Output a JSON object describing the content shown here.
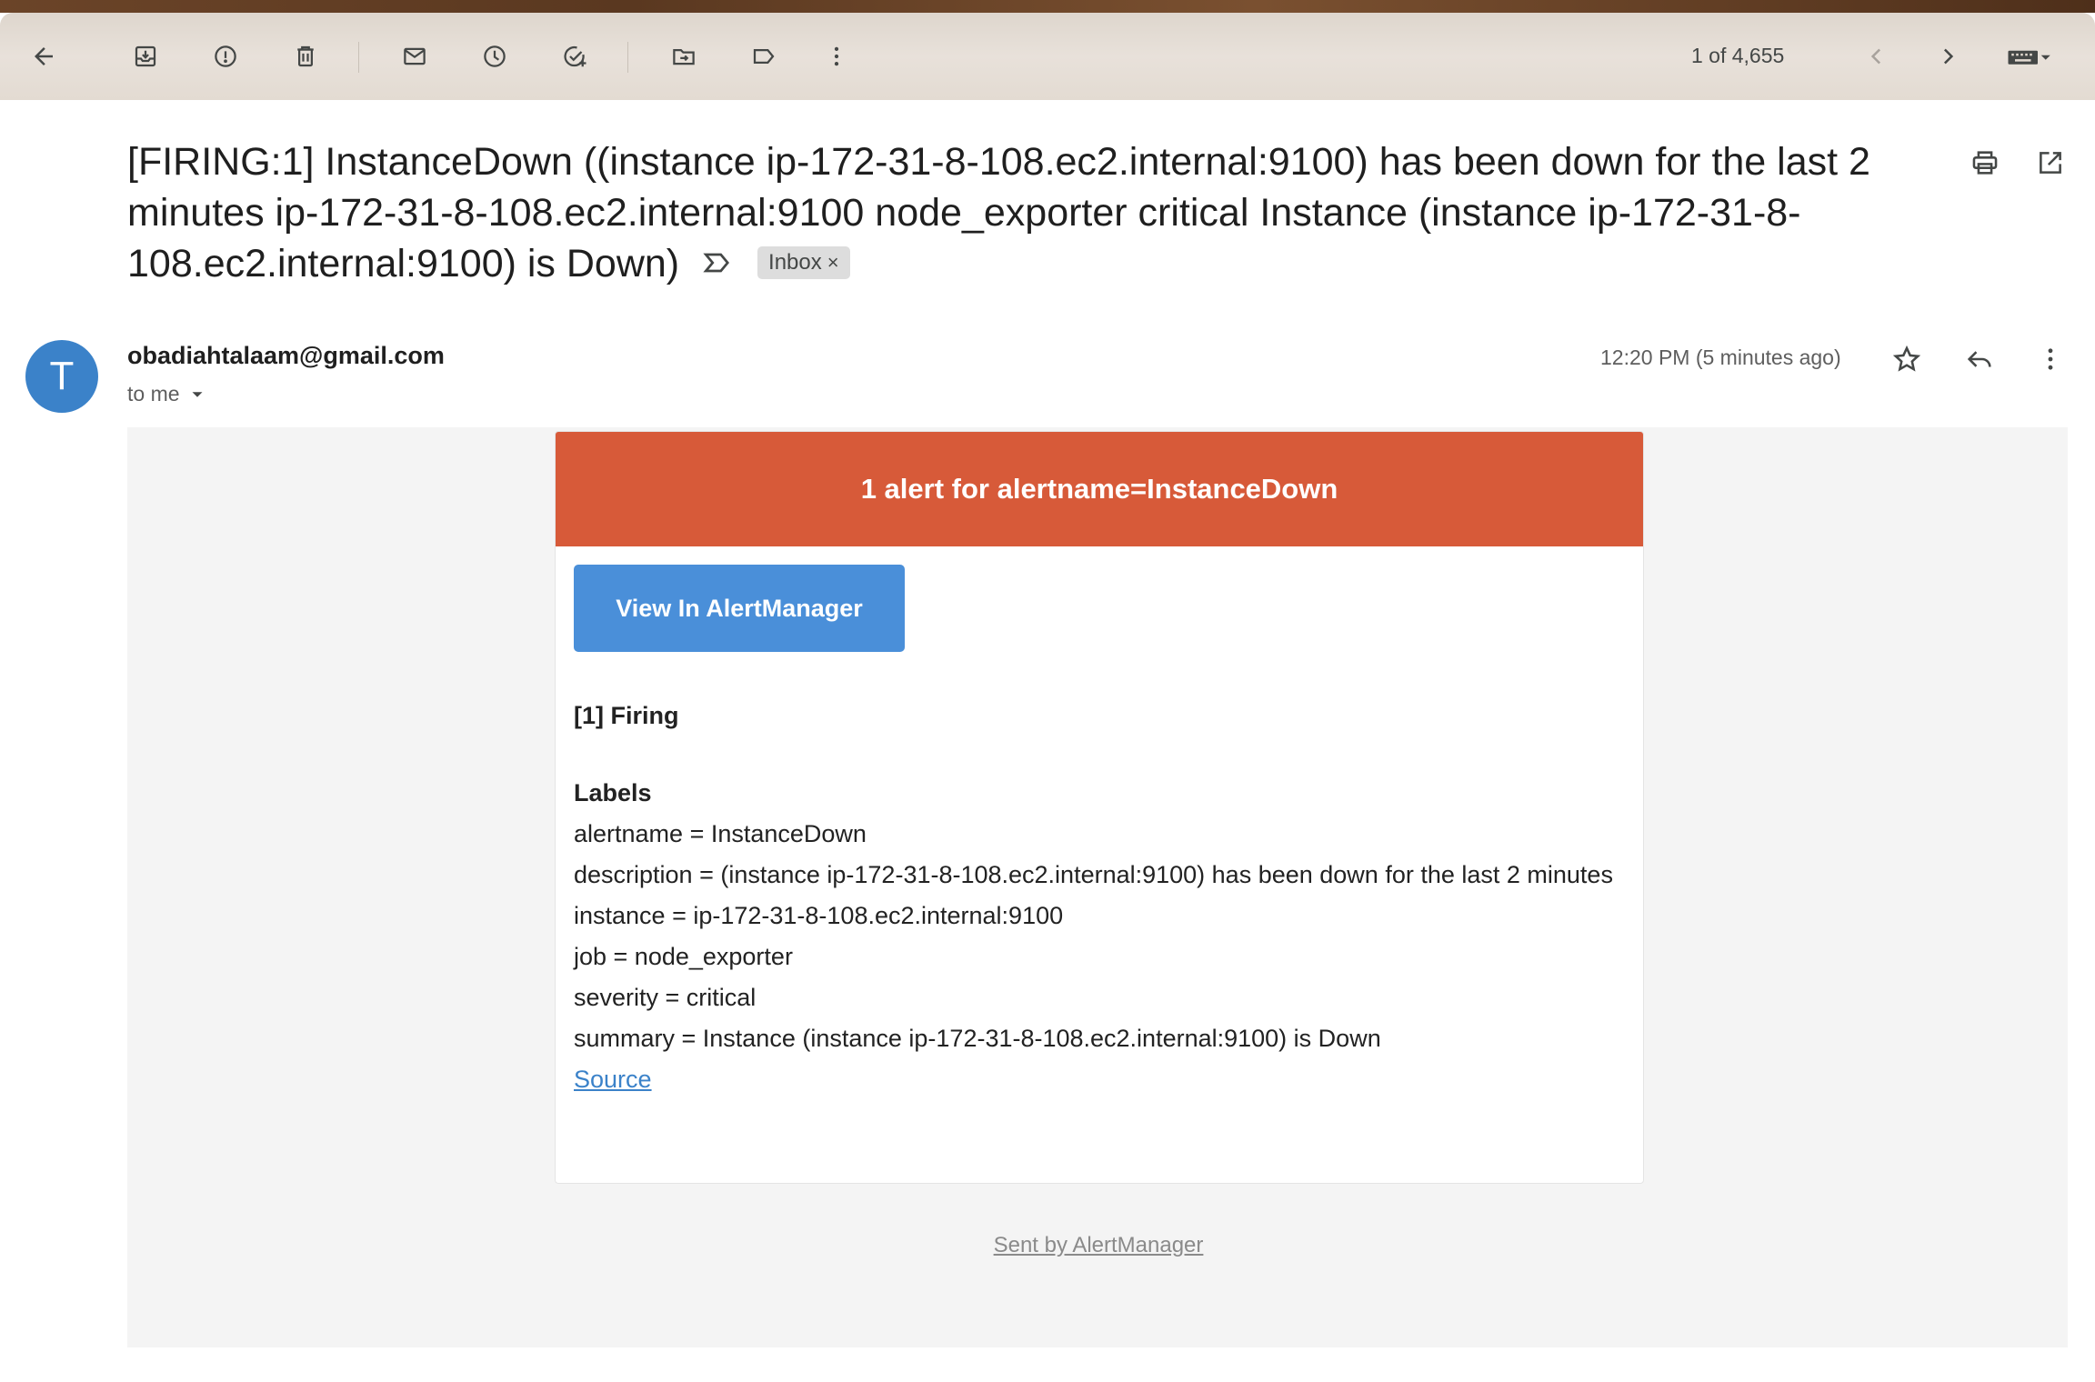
{
  "toolbar": {
    "icons": [
      "back-arrow-icon",
      "archive-icon",
      "report-spam-icon",
      "delete-icon",
      "mark-unread-icon",
      "snooze-icon",
      "add-task-icon",
      "move-to-icon",
      "label-icon",
      "more-vert-icon"
    ],
    "pager_count": "1 of 4,655",
    "input_tools_icon": "keyboard-icon"
  },
  "email": {
    "subject": "[FIRING:1] InstanceDown ((instance ip-172-31-8-108.ec2.internal:9100) has been down for the last 2 minutes ip-172-31-8-108.ec2.internal:9100 node_exporter critical Instance (instance ip-172-31-8-108.ec2.internal:9100) is Down)",
    "label_chip": "Inbox",
    "label_chip_remove": "×",
    "sender_initial": "T",
    "sender": "obadiahtalaam@gmail.com",
    "recipient": "to me",
    "time": "12:20 PM (5 minutes ago)"
  },
  "alert": {
    "banner": "1 alert for alertname=InstanceDown",
    "button": "View In AlertManager",
    "firing": "[1] Firing",
    "labels_heading": "Labels",
    "labels": [
      "alertname = InstanceDown",
      "description = (instance ip-172-31-8-108.ec2.internal:9100) has been down for the last 2 minutes",
      "instance = ip-172-31-8-108.ec2.internal:9100",
      "job = node_exporter",
      "severity = critical",
      "summary = Instance (instance ip-172-31-8-108.ec2.internal:9100) is Down"
    ],
    "source_link": "Source",
    "footer": "Sent by AlertManager"
  },
  "colors": {
    "banner": "#d75a39",
    "button": "#4a8fd9",
    "avatar": "#3b82c9",
    "body_bg": "#f4f4f4"
  }
}
